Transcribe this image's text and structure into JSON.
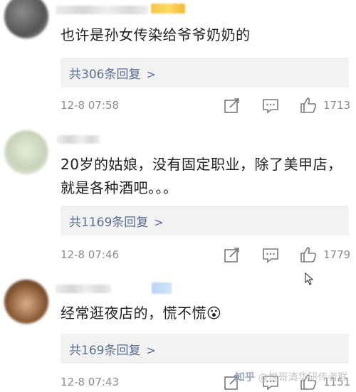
{
  "comments": [
    {
      "text": "也许是孙女传染给爷爷奶奶的",
      "reply_label": "共306条回复",
      "reply_chevron": ">",
      "time": "12-8 07:58",
      "likes": "1713"
    },
    {
      "text": "20岁的姑娘，没有固定职业，除了美甲店，就是各种酒吧。。。",
      "reply_label": "共1169条回复",
      "reply_chevron": ">",
      "time": "12-8 07:46",
      "likes": "1779"
    },
    {
      "text": "经常逛夜店的，慌不慌😮",
      "reply_label": "共169条回复",
      "reply_chevron": ">",
      "time": "12-8 07:43",
      "likes": "1151"
    }
  ],
  "watermark": {
    "logo": "知乎",
    "author": "@悦哥清华研传者联"
  },
  "colors": {
    "reply_link": "#5a6e92",
    "reply_box": "#f2f2f2",
    "meta_text": "#8c8c8c"
  },
  "icons": [
    "repost-icon",
    "comment-icon",
    "thumbs-up-icon",
    "mouse-cursor-icon"
  ]
}
